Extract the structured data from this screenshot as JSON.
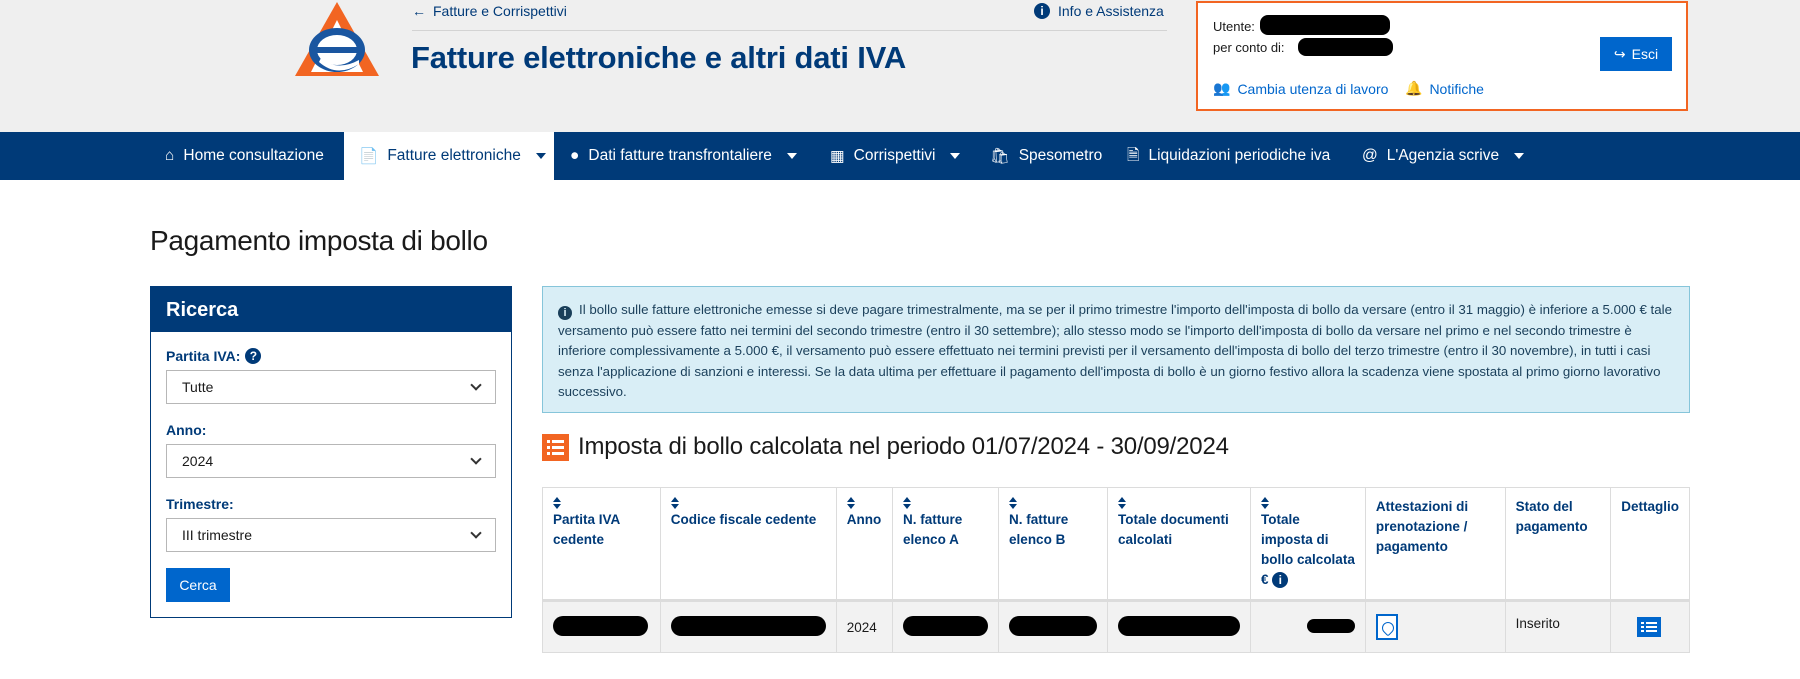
{
  "header": {
    "back_link": "Fatture e Corrispettivi",
    "info_link": "Info e Assistenza",
    "title": "Fatture elettroniche e altri dati IVA",
    "logo_icon": "agenzia-entrate-logo"
  },
  "user": {
    "user_label": "Utente:",
    "on_behalf_label": "per conto di:",
    "exit_label": "Esci",
    "change_user_label": "Cambia utenza di lavoro",
    "notifications_label": "Notifiche"
  },
  "nav": {
    "items": [
      {
        "label": "Home consultazione",
        "icon": "home-icon"
      },
      {
        "label": "Fatture elettroniche",
        "icon": "document-icon",
        "active": true
      },
      {
        "label": "Dati fatture transfrontaliere",
        "icon": "globe-icon"
      },
      {
        "label": "Corrispettivi",
        "icon": "calculator-icon"
      },
      {
        "label": "Spesometro",
        "icon": "shopping-bag-icon"
      },
      {
        "label": "Liquidazioni periodiche iva",
        "icon": "file-icon"
      },
      {
        "label": "L'Agenzia scrive",
        "icon": "at-icon"
      }
    ]
  },
  "page": {
    "title": "Pagamento imposta di bollo"
  },
  "search": {
    "heading": "Ricerca",
    "partita_iva_label": "Partita IVA:",
    "partita_iva_value": "Tutte",
    "anno_label": "Anno:",
    "anno_value": "2024",
    "trimestre_label": "Trimestre:",
    "trimestre_value": "III trimestre",
    "button_label": "Cerca"
  },
  "info_text": "Il bollo sulle fatture elettroniche emesse si deve pagare trimestralmente, ma se per il primo trimestre l'importo dell'imposta di bollo da versare (entro il 31 maggio) è inferiore a 5.000 € tale versamento può essere fatto nei termini del secondo trimestre (entro il 30 settembre); allo stesso modo se l'importo dell'imposta di bollo da versare nel primo e nel secondo trimestre è inferiore complessivamente a 5.000 €, il versamento può essere effettuato nei termini previsti per il versamento dell'imposta di bollo del terzo trimestre (entro il 30 novembre), in tutti i casi senza l'applicazione di sanzioni e interessi. Se la data ultima per effettuare il pagamento dell'imposta di bollo è un giorno festivo allora la scadenza viene spostata al primo giorno lavorativo successivo.",
  "section": {
    "title": "Imposta di bollo calcolata nel periodo 01/07/2024 - 30/09/2024"
  },
  "table": {
    "headers": [
      "Partita IVA cedente",
      "Codice fiscale cedente",
      "Anno",
      "N. fatture elenco A",
      "N. fatture elenco B",
      "Totale documenti calcolati",
      "Totale imposta di bollo calcolata €",
      "Attestazioni di prenotazione / pagamento",
      "Stato del pagamento",
      "Dettaglio"
    ],
    "row": {
      "anno": "2024",
      "stato": "Inserito"
    }
  },
  "colors": {
    "brand_blue": "#003a78",
    "accent_orange": "#f26522",
    "link_blue": "#0066cc",
    "info_bg": "#d9eef6"
  }
}
